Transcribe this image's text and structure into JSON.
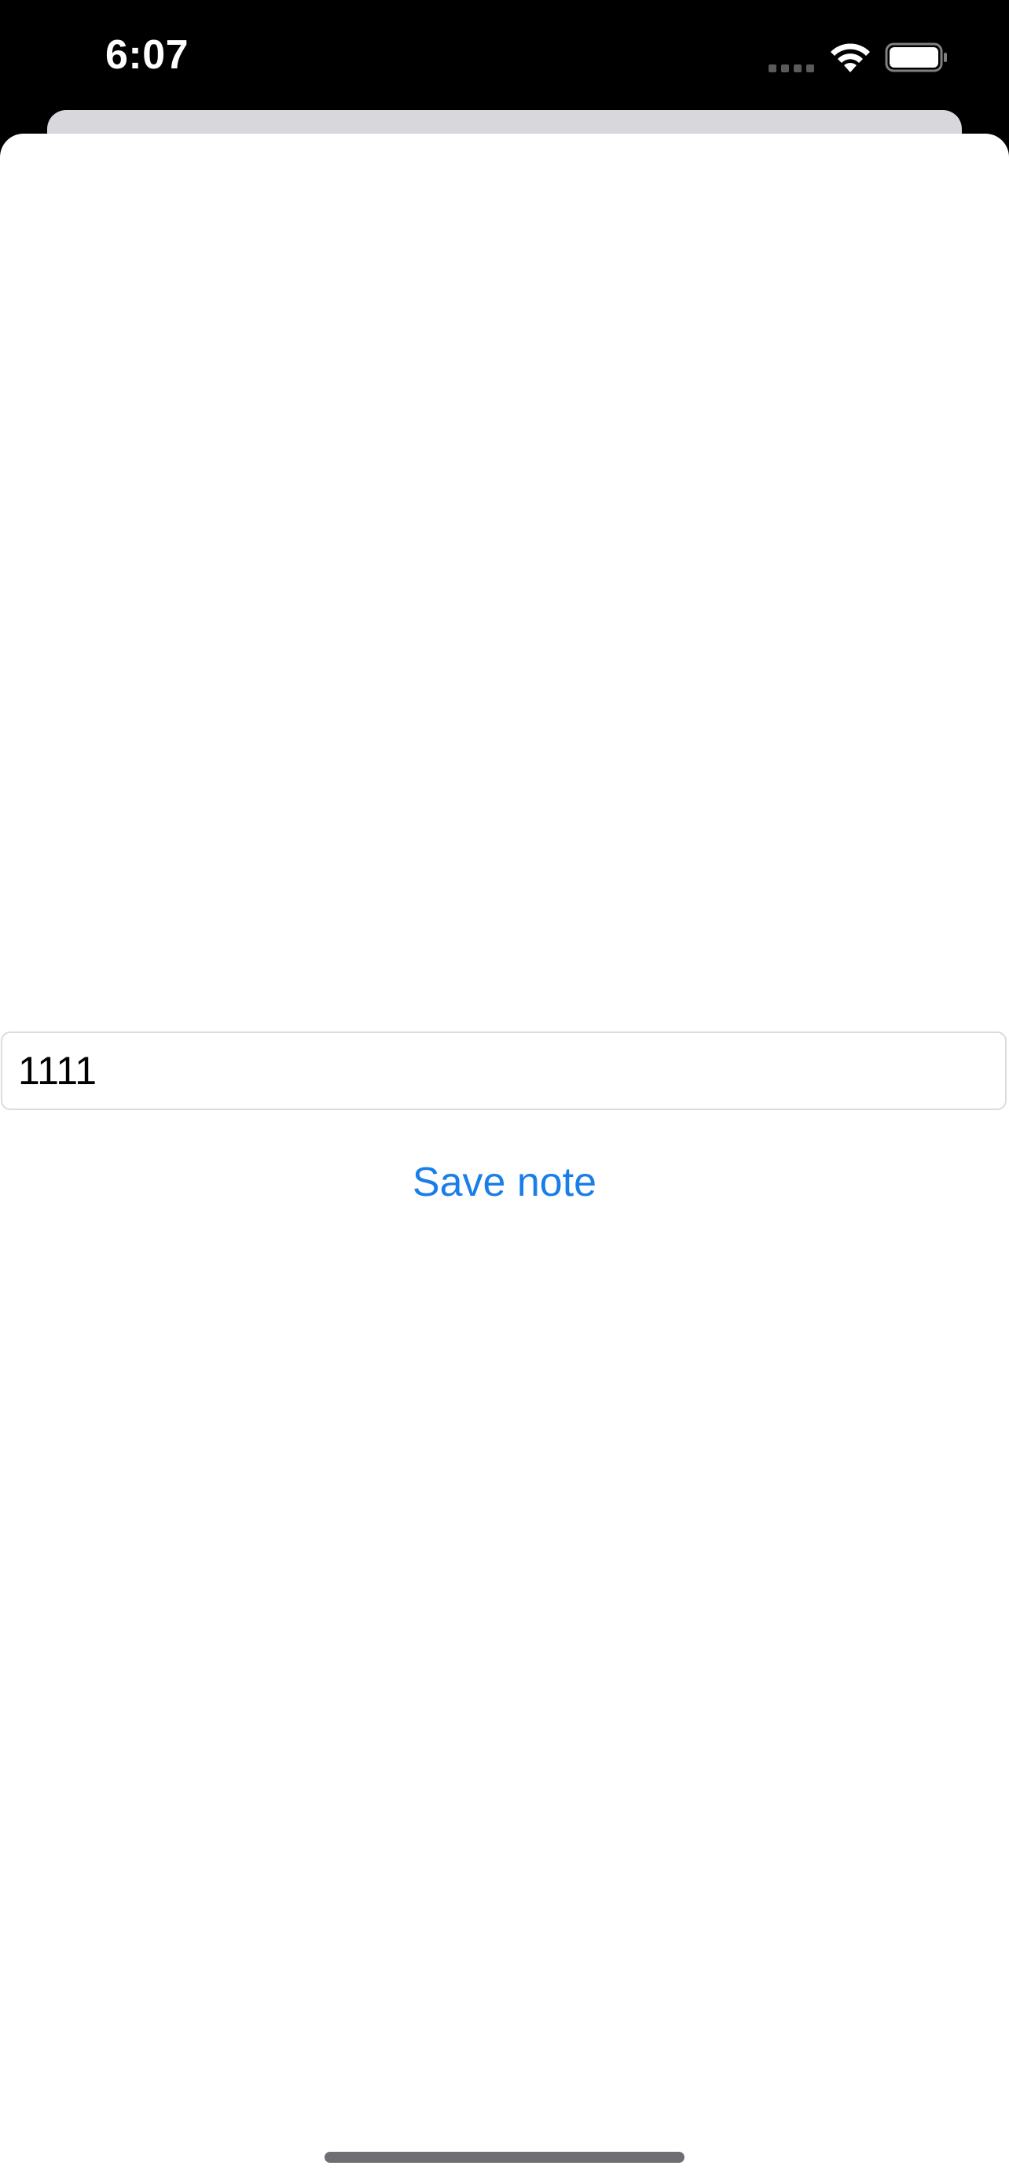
{
  "status_bar": {
    "time": "6:07",
    "icons": [
      "cellular-signal-icon",
      "wifi-icon",
      "battery-icon"
    ]
  },
  "note": {
    "value": "1111",
    "save_label": "Save note"
  },
  "colors": {
    "accent": "#1a7ee8",
    "background": "#ffffff",
    "status_bar": "#000000",
    "sheet_behind": "#d7d7dc"
  }
}
